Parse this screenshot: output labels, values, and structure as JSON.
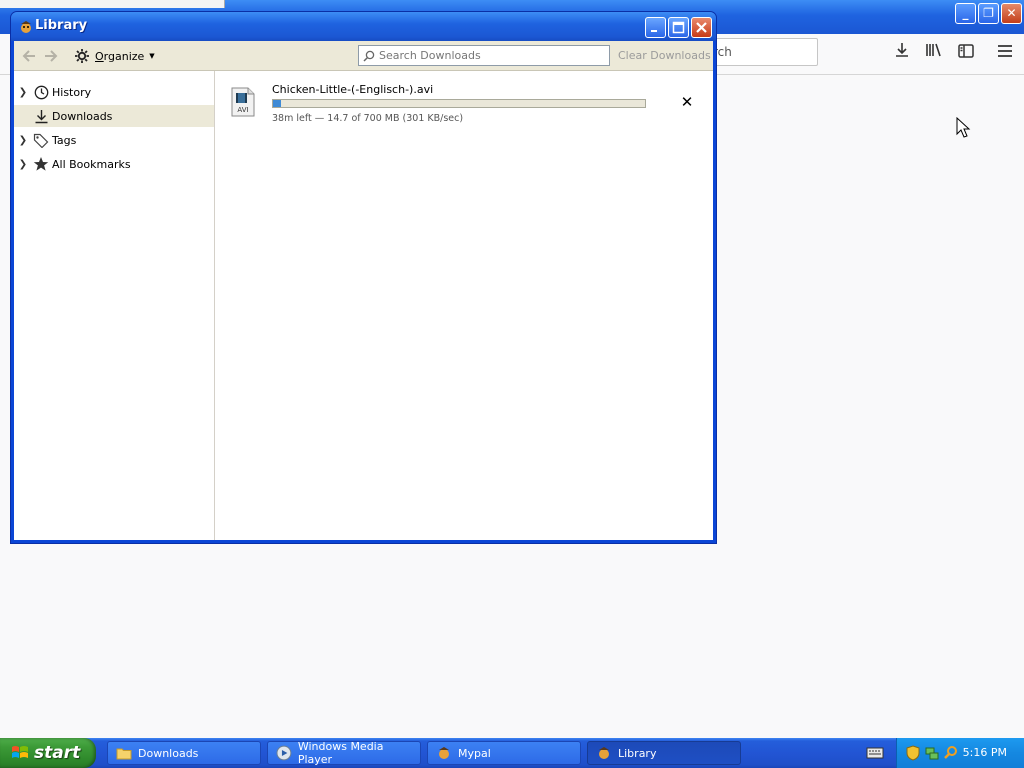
{
  "background_browser": {
    "search_placeholder": "rch",
    "toolbar_icons": [
      "download-icon",
      "library-icon",
      "sidebar-icon",
      "menu-icon"
    ],
    "window_controls": [
      "minimize",
      "restore",
      "close"
    ]
  },
  "library": {
    "title": "Library",
    "toolbar": {
      "organize_label": "Organize",
      "search_placeholder": "Search Downloads",
      "clear_label": "Clear Downloads"
    },
    "sidebar": {
      "items": [
        {
          "label": "History",
          "icon": "clock-icon",
          "expandable": true,
          "selected": false
        },
        {
          "label": "Downloads",
          "icon": "download-icon",
          "expandable": false,
          "selected": true
        },
        {
          "label": "Tags",
          "icon": "tag-icon",
          "expandable": true,
          "selected": false
        },
        {
          "label": "All Bookmarks",
          "icon": "star-icon",
          "expandable": true,
          "selected": false
        }
      ]
    },
    "downloads": [
      {
        "file_name": "Chicken-Little-(-Englisch-).avi",
        "file_type": "AVI",
        "status": "38m left — 14.7 of 700 MB (301 KB/sec)",
        "progress_percent": 2.1
      }
    ]
  },
  "taskbar": {
    "start_label": "start",
    "tasks": [
      {
        "label": "Downloads",
        "icon": "folder-icon",
        "active": false
      },
      {
        "label": "Windows Media Player",
        "icon": "media-player-icon",
        "active": false
      },
      {
        "label": "Mypal",
        "icon": "mypal-icon",
        "active": false
      },
      {
        "label": "Library",
        "icon": "mypal-icon",
        "active": true
      }
    ],
    "clock": "5:16 PM"
  },
  "colors": {
    "xp_blue": "#245edb",
    "start_green": "#3c9a37",
    "progress_fill": "#3f8ad6",
    "selection": "#ece9d8"
  }
}
